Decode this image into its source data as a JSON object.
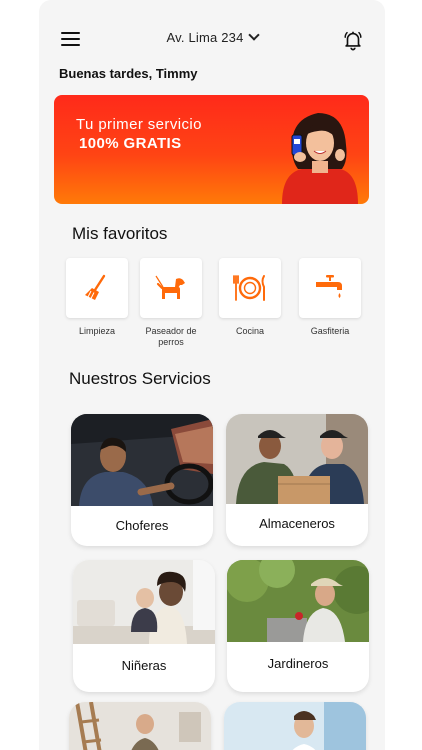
{
  "header": {
    "address": "Av. Lima 234"
  },
  "greeting": "Buenas tardes, Timmy",
  "promo": {
    "line1": "Tu primer servicio",
    "line2": "100% GRATIS"
  },
  "favorites": {
    "title": "Mis favoritos",
    "items": [
      {
        "label": "Limpieza",
        "icon": "broom-icon"
      },
      {
        "label": "Paseador de perros",
        "icon": "dog-icon"
      },
      {
        "label": "Cocina",
        "icon": "plate-icon"
      },
      {
        "label": "Gasfiteria",
        "icon": "faucet-icon"
      }
    ]
  },
  "services": {
    "title": "Nuestros Servicios",
    "items": [
      {
        "label": "Choferes"
      },
      {
        "label": "Almaceneros"
      },
      {
        "label": "Niñeras"
      },
      {
        "label": "Jardineros"
      }
    ]
  },
  "colors": {
    "accent": "#ff6a0a",
    "banner_top": "#ff2a1a",
    "banner_bottom": "#ff7a08"
  }
}
